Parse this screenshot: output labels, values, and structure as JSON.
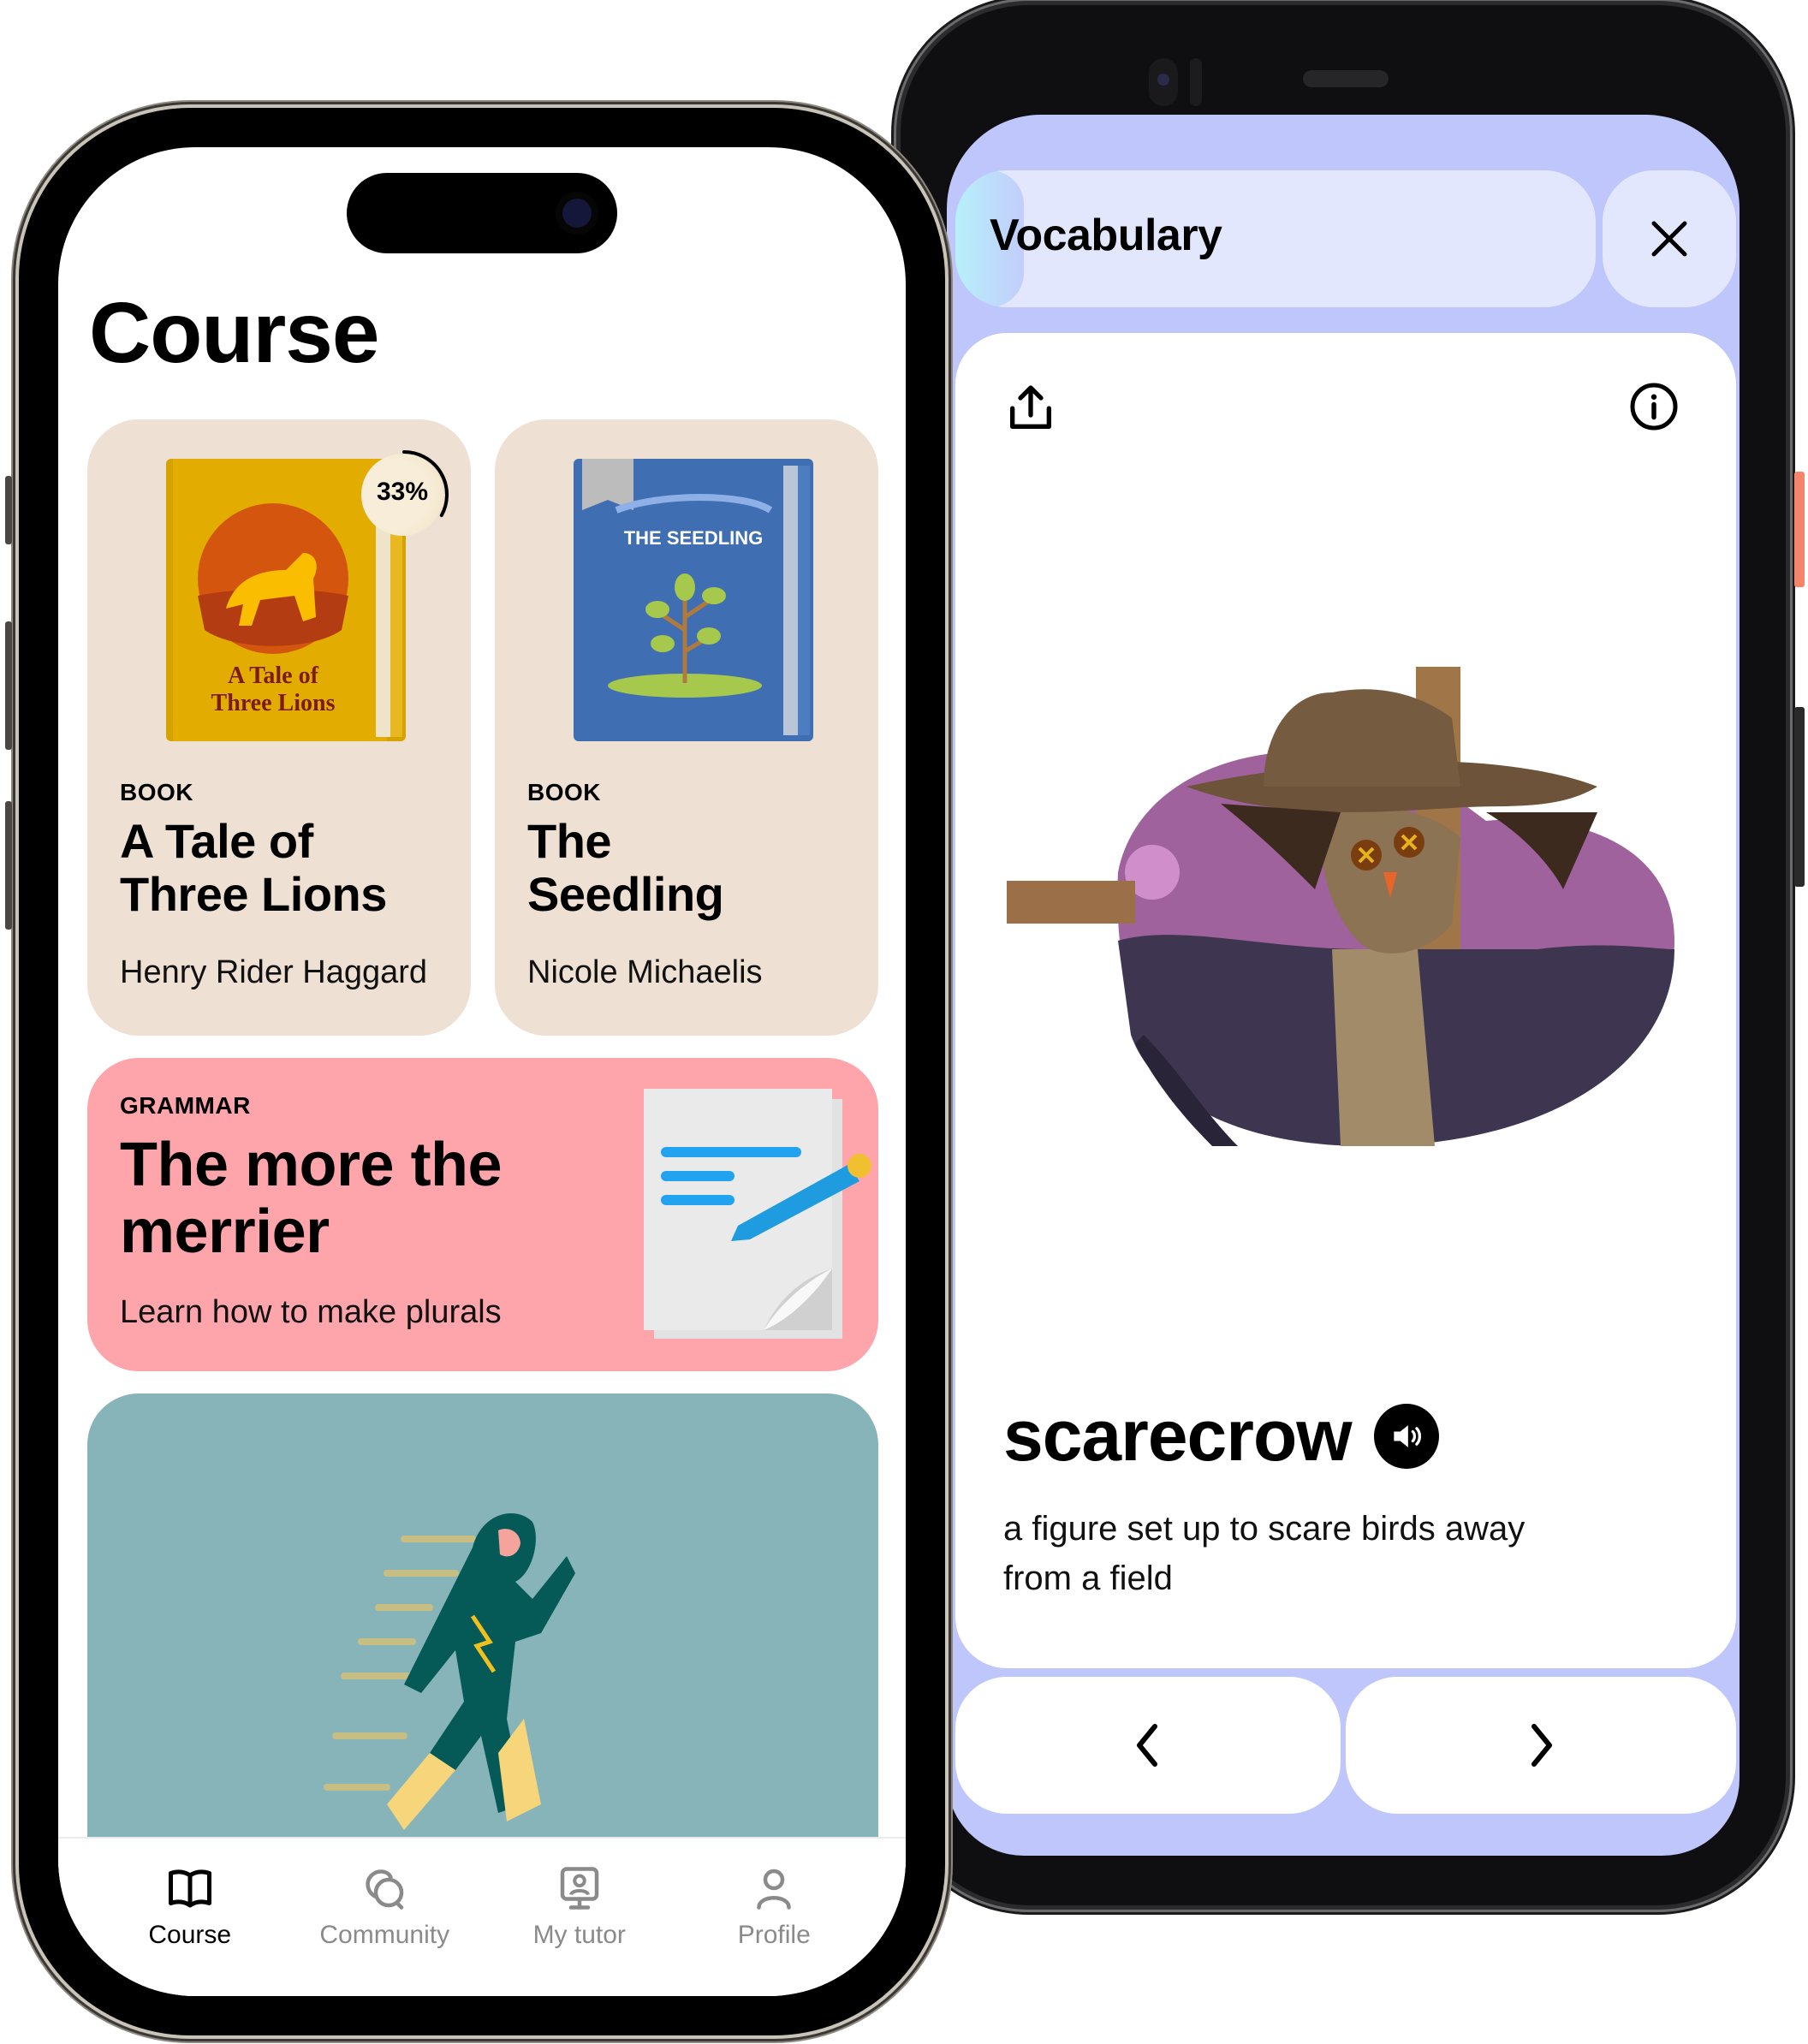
{
  "course_app": {
    "page_title": "Course",
    "books": [
      {
        "tag": "BOOK",
        "title": "A Tale of Three Lions",
        "title_lines": [
          "A Tale of",
          "Three Lions"
        ],
        "author": "Henry Rider Haggard",
        "cover_text": [
          "A Tale of",
          "Three Lions"
        ],
        "progress_label": "33%",
        "progress": 0.33,
        "cover_color": "#e0ac00"
      },
      {
        "tag": "BOOK",
        "title": "The Seedling",
        "title_lines": [
          "The",
          "Seedling"
        ],
        "author": "Nicole Michaelis",
        "cover_text": "THE SEEDLING",
        "cover_color": "#4273b7"
      }
    ],
    "grammar": {
      "tag": "GRAMMAR",
      "title": "The more the merrier",
      "title_lines": [
        "The more the",
        "merrier"
      ],
      "subtitle": "Learn how to make plurals"
    },
    "tabs": [
      {
        "label": "Course",
        "icon": "book-open-icon",
        "active": true
      },
      {
        "label": "Community",
        "icon": "chat-bubbles-icon",
        "active": false
      },
      {
        "label": "My tutor",
        "icon": "tutor-screen-icon",
        "active": false
      },
      {
        "label": "Profile",
        "icon": "person-icon",
        "active": false
      }
    ],
    "colors": {
      "book_card_bg": "#eee0d3",
      "grammar_card_bg": "#fea5ac",
      "hero_card_bg": "#86b4b9",
      "tab_inactive": "#8a8a8a"
    }
  },
  "vocab_app": {
    "header_title": "Vocabulary",
    "word": "scarecrow",
    "definition": "a figure set up to scare birds away from a field",
    "buttons": {
      "close": "close",
      "share": "share",
      "info": "info",
      "audio": "play pronunciation",
      "prev": "previous",
      "next": "next"
    },
    "colors": {
      "background": "#bec6fc",
      "header_bg": "#e3e7fd"
    }
  }
}
